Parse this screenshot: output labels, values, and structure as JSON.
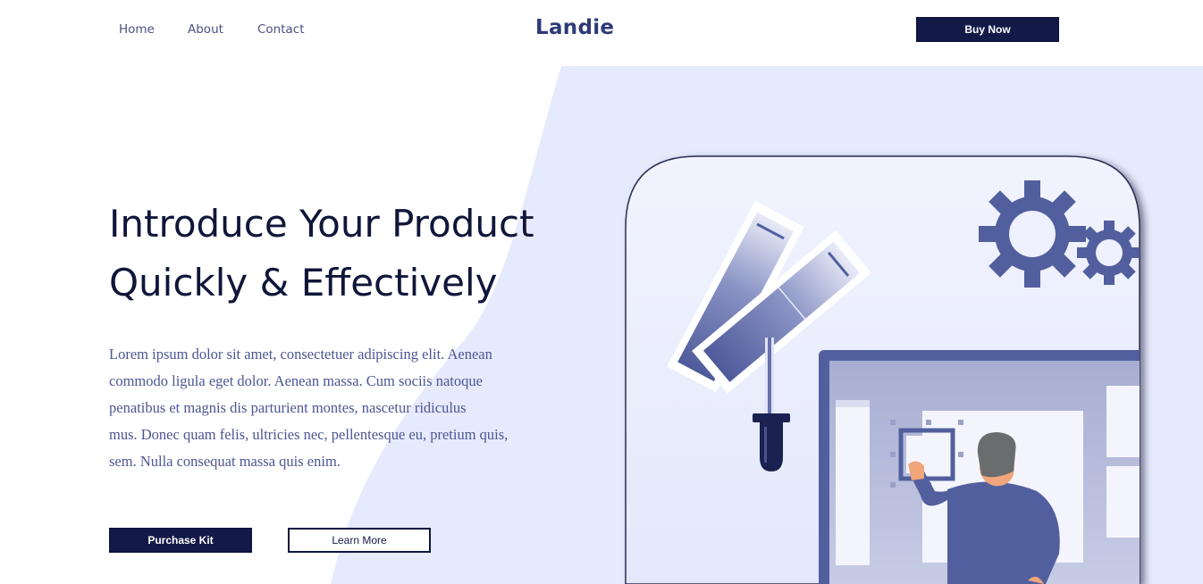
{
  "header": {
    "nav": [
      "Home",
      "About",
      "Contact"
    ],
    "logo": "Landie",
    "cta_label": "Buy Now"
  },
  "hero": {
    "title_lines": [
      "Introduce Your Product",
      "Quickly & Effectively"
    ],
    "body_lines": [
      "Lorem ipsum dolor sit amet, consectetuer adipiscing elit. Aenean",
      "commodo ligula eget dolor. Aenean massa. Cum sociis natoque",
      "penatibus et magnis dis parturient montes, nascetur ridiculus",
      "mus. Donec quam felis, ultricies nec, pellentesque eu, pretium quis,",
      "sem. Nulla consequat massa quis enim."
    ],
    "primary_button": "Purchase Kit",
    "secondary_button": "Learn More"
  },
  "colors": {
    "primary": "#131a48",
    "background_shape": "#e6eafd",
    "illustration_accent": "#525f9e"
  },
  "icons": [
    "gear-icon",
    "color-swatch-icon",
    "eyedropper-icon",
    "monitor-icon",
    "person-icon"
  ]
}
